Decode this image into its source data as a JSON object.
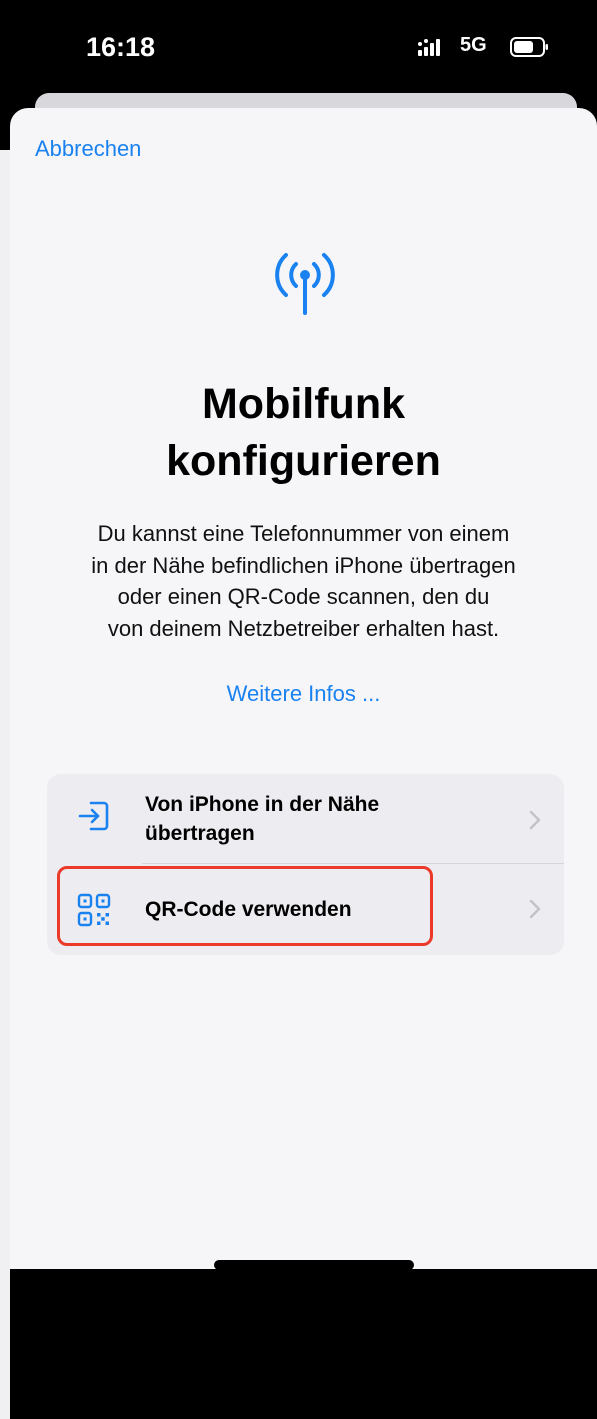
{
  "status_bar": {
    "time": "16:18",
    "network": "5G"
  },
  "sheet": {
    "cancel_label": "Abbrechen",
    "header_icon": "antenna-radiowaves-icon",
    "title_line1": "Mobilfunk",
    "title_line2": "konfigurieren",
    "description_lines": [
      "Du kannst eine Telefonnummer von einem",
      "in der Nähe befindlichen iPhone übertragen",
      "oder einen QR-Code scannen, den du",
      "von deinem Netzbetreiber erhalten hast."
    ],
    "more_info_label": "Weitere Infos ...",
    "options": [
      {
        "label_line1": "Von iPhone in der Nähe",
        "label_line2": "übertragen",
        "icon": "transfer-into-icon",
        "highlighted": false
      },
      {
        "label_line1": "QR-Code verwenden",
        "icon": "qr-code-icon",
        "highlighted": true
      }
    ]
  },
  "colors": {
    "accent": "#1a82f0",
    "highlight_box": "#ec3a2a",
    "sheet_background": "#f6f6f8",
    "group_background": "#ececf1"
  }
}
